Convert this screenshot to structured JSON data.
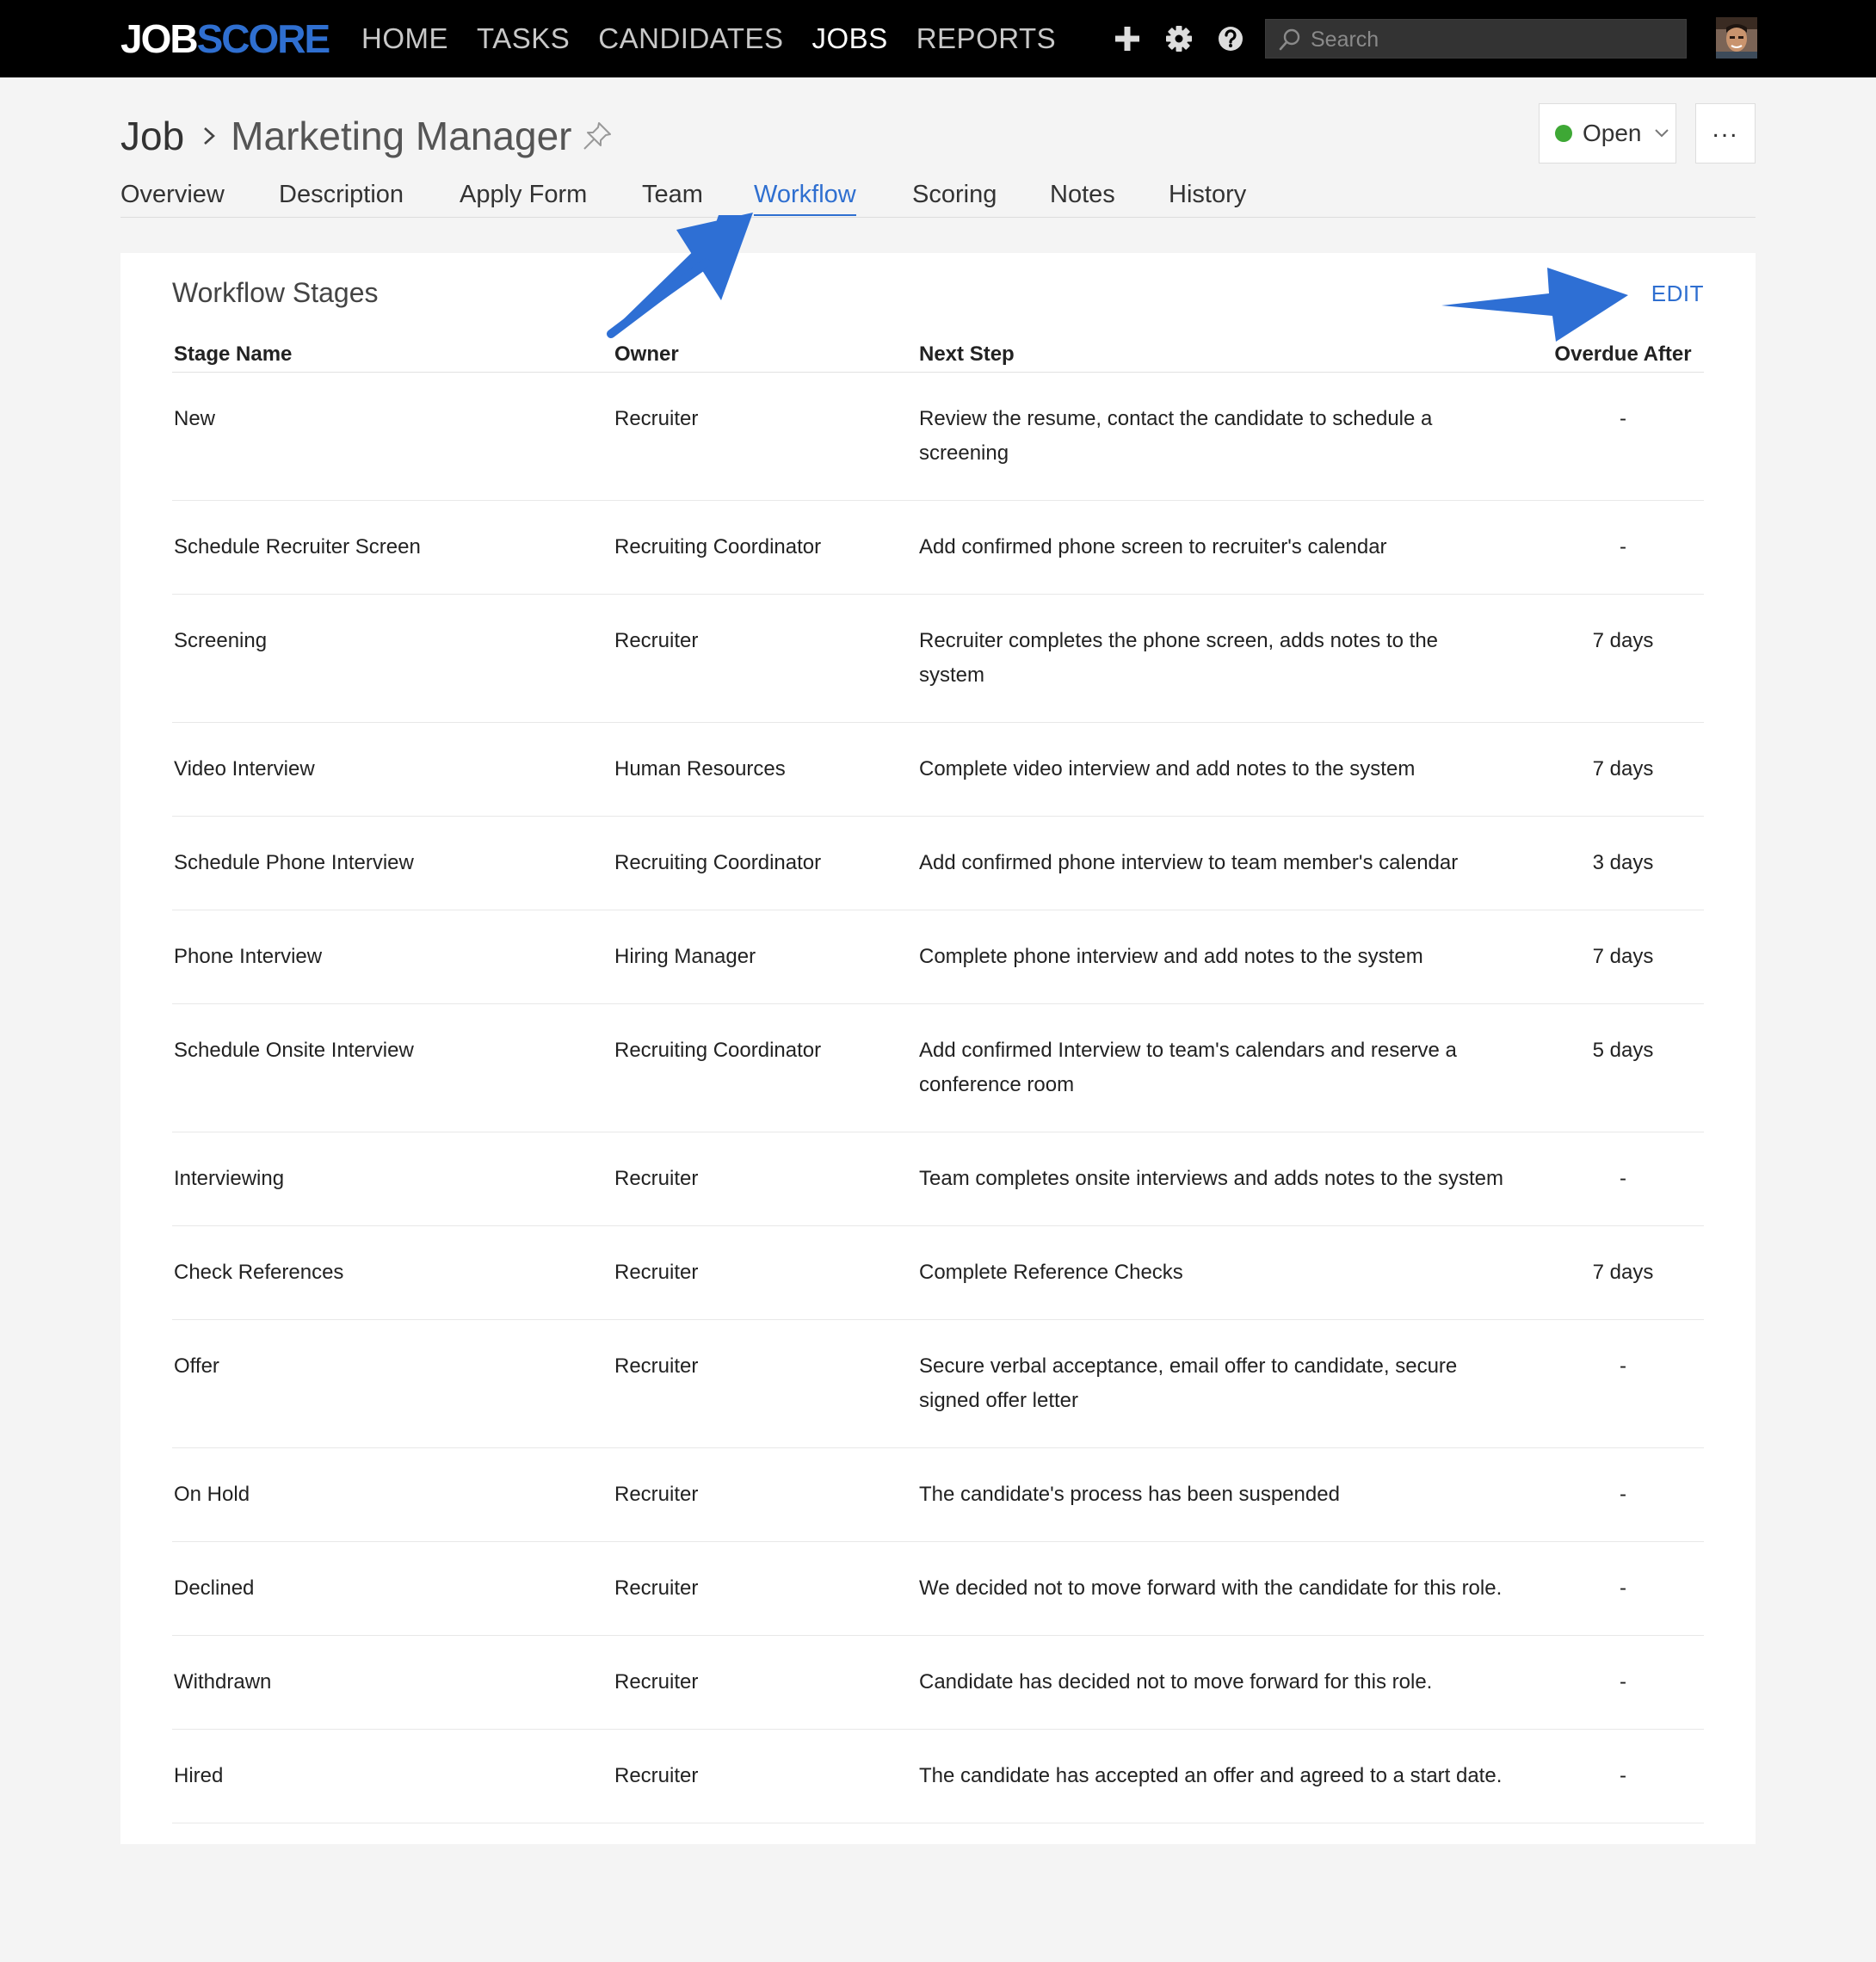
{
  "nav": {
    "logo_job": "JOB",
    "logo_score": "SCORE",
    "items": [
      {
        "label": "HOME",
        "active": false
      },
      {
        "label": "TASKS",
        "active": false
      },
      {
        "label": "CANDIDATES",
        "active": false
      },
      {
        "label": "JOBS",
        "active": true
      },
      {
        "label": "REPORTS",
        "active": false
      }
    ],
    "icons": [
      "plus-icon",
      "gear-icon",
      "help-icon"
    ],
    "search_placeholder": "Search"
  },
  "header": {
    "breadcrumb_root": "Job",
    "title": "Marketing Manager",
    "status": "Open",
    "status_color": "#3ea835",
    "more_label": "..."
  },
  "tabs": [
    "Overview",
    "Description",
    "Apply Form",
    "Team",
    "Workflow",
    "Scoring",
    "Notes",
    "History"
  ],
  "active_tab": "Workflow",
  "accent_color": "#2f6fd0",
  "workflow": {
    "title": "Workflow Stages",
    "edit_label": "EDIT",
    "columns": [
      "Stage Name",
      "Owner",
      "Next Step",
      "Overdue After"
    ],
    "rows": [
      [
        "New",
        "Recruiter",
        "Review the resume, contact the candidate to schedule a screening",
        "-"
      ],
      [
        "Schedule Recruiter Screen",
        "Recruiting Coordinator",
        "Add confirmed phone screen to recruiter's calendar",
        "-"
      ],
      [
        "Screening",
        "Recruiter",
        "Recruiter completes the phone screen, adds notes to the system",
        "7 days"
      ],
      [
        "Video Interview",
        "Human Resources",
        "Complete video interview and add notes to the system",
        "7 days"
      ],
      [
        "Schedule Phone Interview",
        "Recruiting Coordinator",
        "Add confirmed phone interview to team member's calendar",
        "3 days"
      ],
      [
        "Phone Interview",
        "Hiring Manager",
        "Complete phone interview and add notes to the system",
        "7 days"
      ],
      [
        "Schedule Onsite Interview",
        "Recruiting Coordinator",
        "Add confirmed Interview to team's calendars and reserve a conference room",
        "5 days"
      ],
      [
        "Interviewing",
        "Recruiter",
        "Team completes onsite interviews and adds notes to the system",
        "-"
      ],
      [
        "Check References",
        "Recruiter",
        "Complete Reference Checks",
        "7 days"
      ],
      [
        "Offer",
        "Recruiter",
        "Secure verbal acceptance, email offer to candidate, secure signed offer letter",
        "-"
      ],
      [
        "On Hold",
        "Recruiter",
        "The candidate's process has been suspended",
        "-"
      ],
      [
        "Declined",
        "Recruiter",
        "We decided not to move forward with the candidate for this role.",
        "-"
      ],
      [
        "Withdrawn",
        "Recruiter",
        "Candidate has decided not to move forward for this role.",
        "-"
      ],
      [
        "Hired",
        "Recruiter",
        "The candidate has accepted an offer and agreed to a start date.",
        "-"
      ]
    ]
  }
}
